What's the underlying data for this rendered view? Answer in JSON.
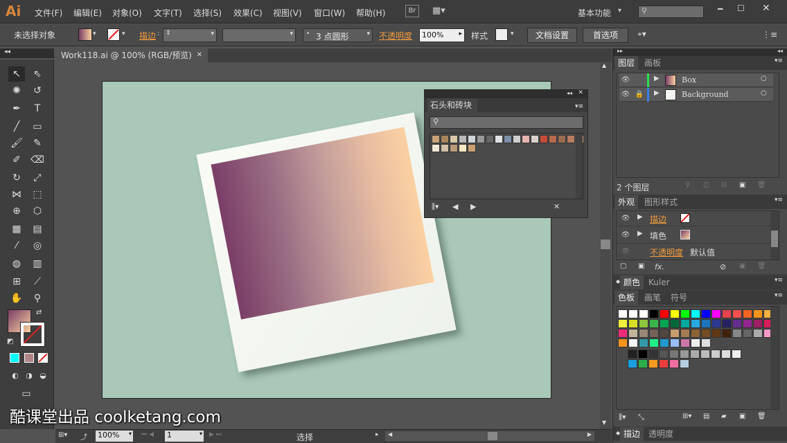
{
  "app": {
    "logo": "Ai",
    "bridge": "Br",
    "workspace": "基本功能",
    "search_placeholder": ""
  },
  "menu": [
    "文件(F)",
    "编辑(E)",
    "对象(O)",
    "文字(T)",
    "选择(S)",
    "效果(C)",
    "视图(V)",
    "窗口(W)",
    "帮助(H)"
  ],
  "control": {
    "selection_label": "未选择对象",
    "stroke_label": "描边",
    "brush_label": "3 点圆形",
    "opacity_label": "不透明度",
    "opacity_value": "100%",
    "style_label": "样式",
    "doc_settings": "文档设置",
    "preferences": "首选项"
  },
  "document": {
    "tab_title": "Work118.ai @ 100% (RGB/预览)",
    "zoom": "100%",
    "page": "1",
    "status": "选择"
  },
  "swatch_panel": {
    "title": "石头和砖块"
  },
  "layers": {
    "tab": "图层",
    "tab2": "画板",
    "items": [
      {
        "name": "Box"
      },
      {
        "name": "Background"
      }
    ],
    "count": "2 个图层"
  },
  "appearance": {
    "tab": "外观",
    "tab2": "图形样式",
    "stroke": "描边",
    "fill": "填色",
    "opacity": "不透明度",
    "opacity_value": "默认值"
  },
  "color": {
    "tab": "颜色",
    "tab2": "Kuler"
  },
  "swatches": {
    "tab": "色板",
    "tab2": "画笔",
    "tab3": "符号"
  },
  "stroke_panel": {
    "tab": "描边",
    "tab2": "透明度"
  },
  "watermark": "酷课堂出品 coolketang.com",
  "colors": {
    "accent": "#f39c3d",
    "artboard": "#a9c8b7",
    "gradient_start": "#7b3e67",
    "gradient_end": "#fbd1a2"
  }
}
